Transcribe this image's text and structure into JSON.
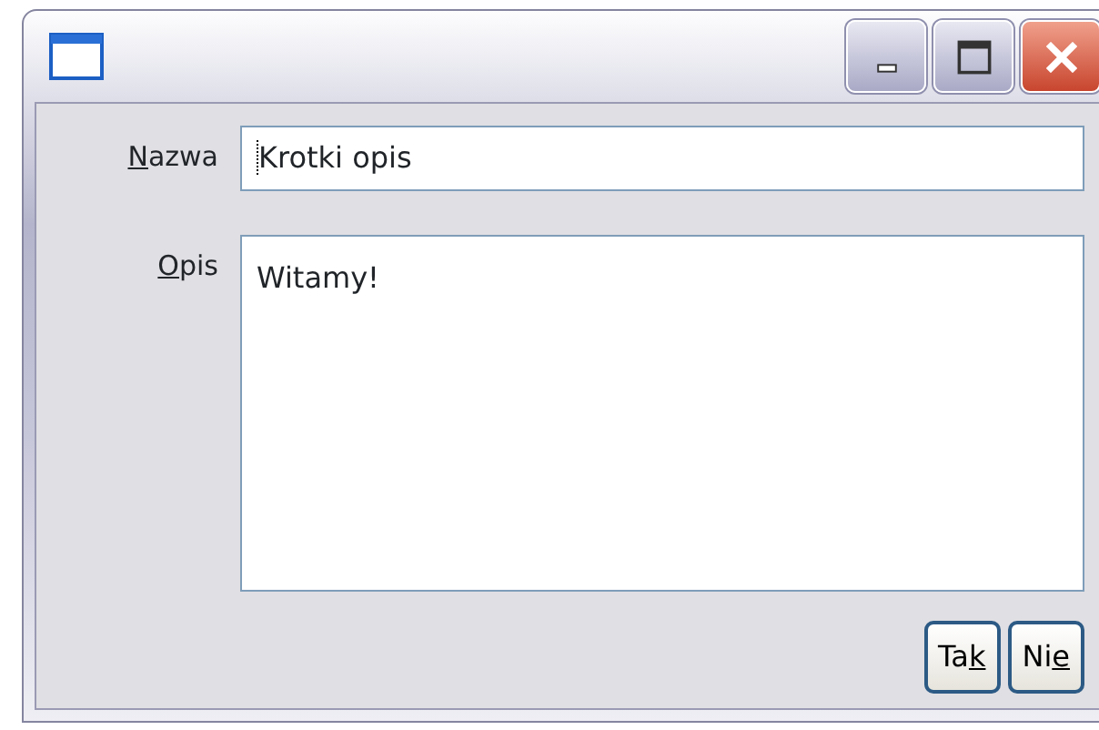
{
  "window": {
    "title_buttons": [
      {
        "kind": "minimize"
      },
      {
        "kind": "maximize"
      },
      {
        "kind": "close"
      }
    ]
  },
  "fields": [
    {
      "kind": "input",
      "label_parts": [
        {
          "text": "N",
          "underlined": true
        },
        {
          "text": "azwa",
          "underlined": false
        }
      ],
      "value": "Krotki opis",
      "focused": true
    },
    {
      "kind": "textarea",
      "label_parts": [
        {
          "text": "O",
          "underlined": true
        },
        {
          "text": "pis",
          "underlined": false
        }
      ],
      "value": "Witamy!",
      "focused": false
    }
  ],
  "buttons": [
    {
      "label_parts": [
        {
          "text": "Ta",
          "underlined": false
        },
        {
          "text": "k",
          "underlined": true
        }
      ]
    },
    {
      "label_parts": [
        {
          "text": "Ni",
          "underlined": false
        },
        {
          "text": "e",
          "underlined": true
        }
      ]
    }
  ]
}
